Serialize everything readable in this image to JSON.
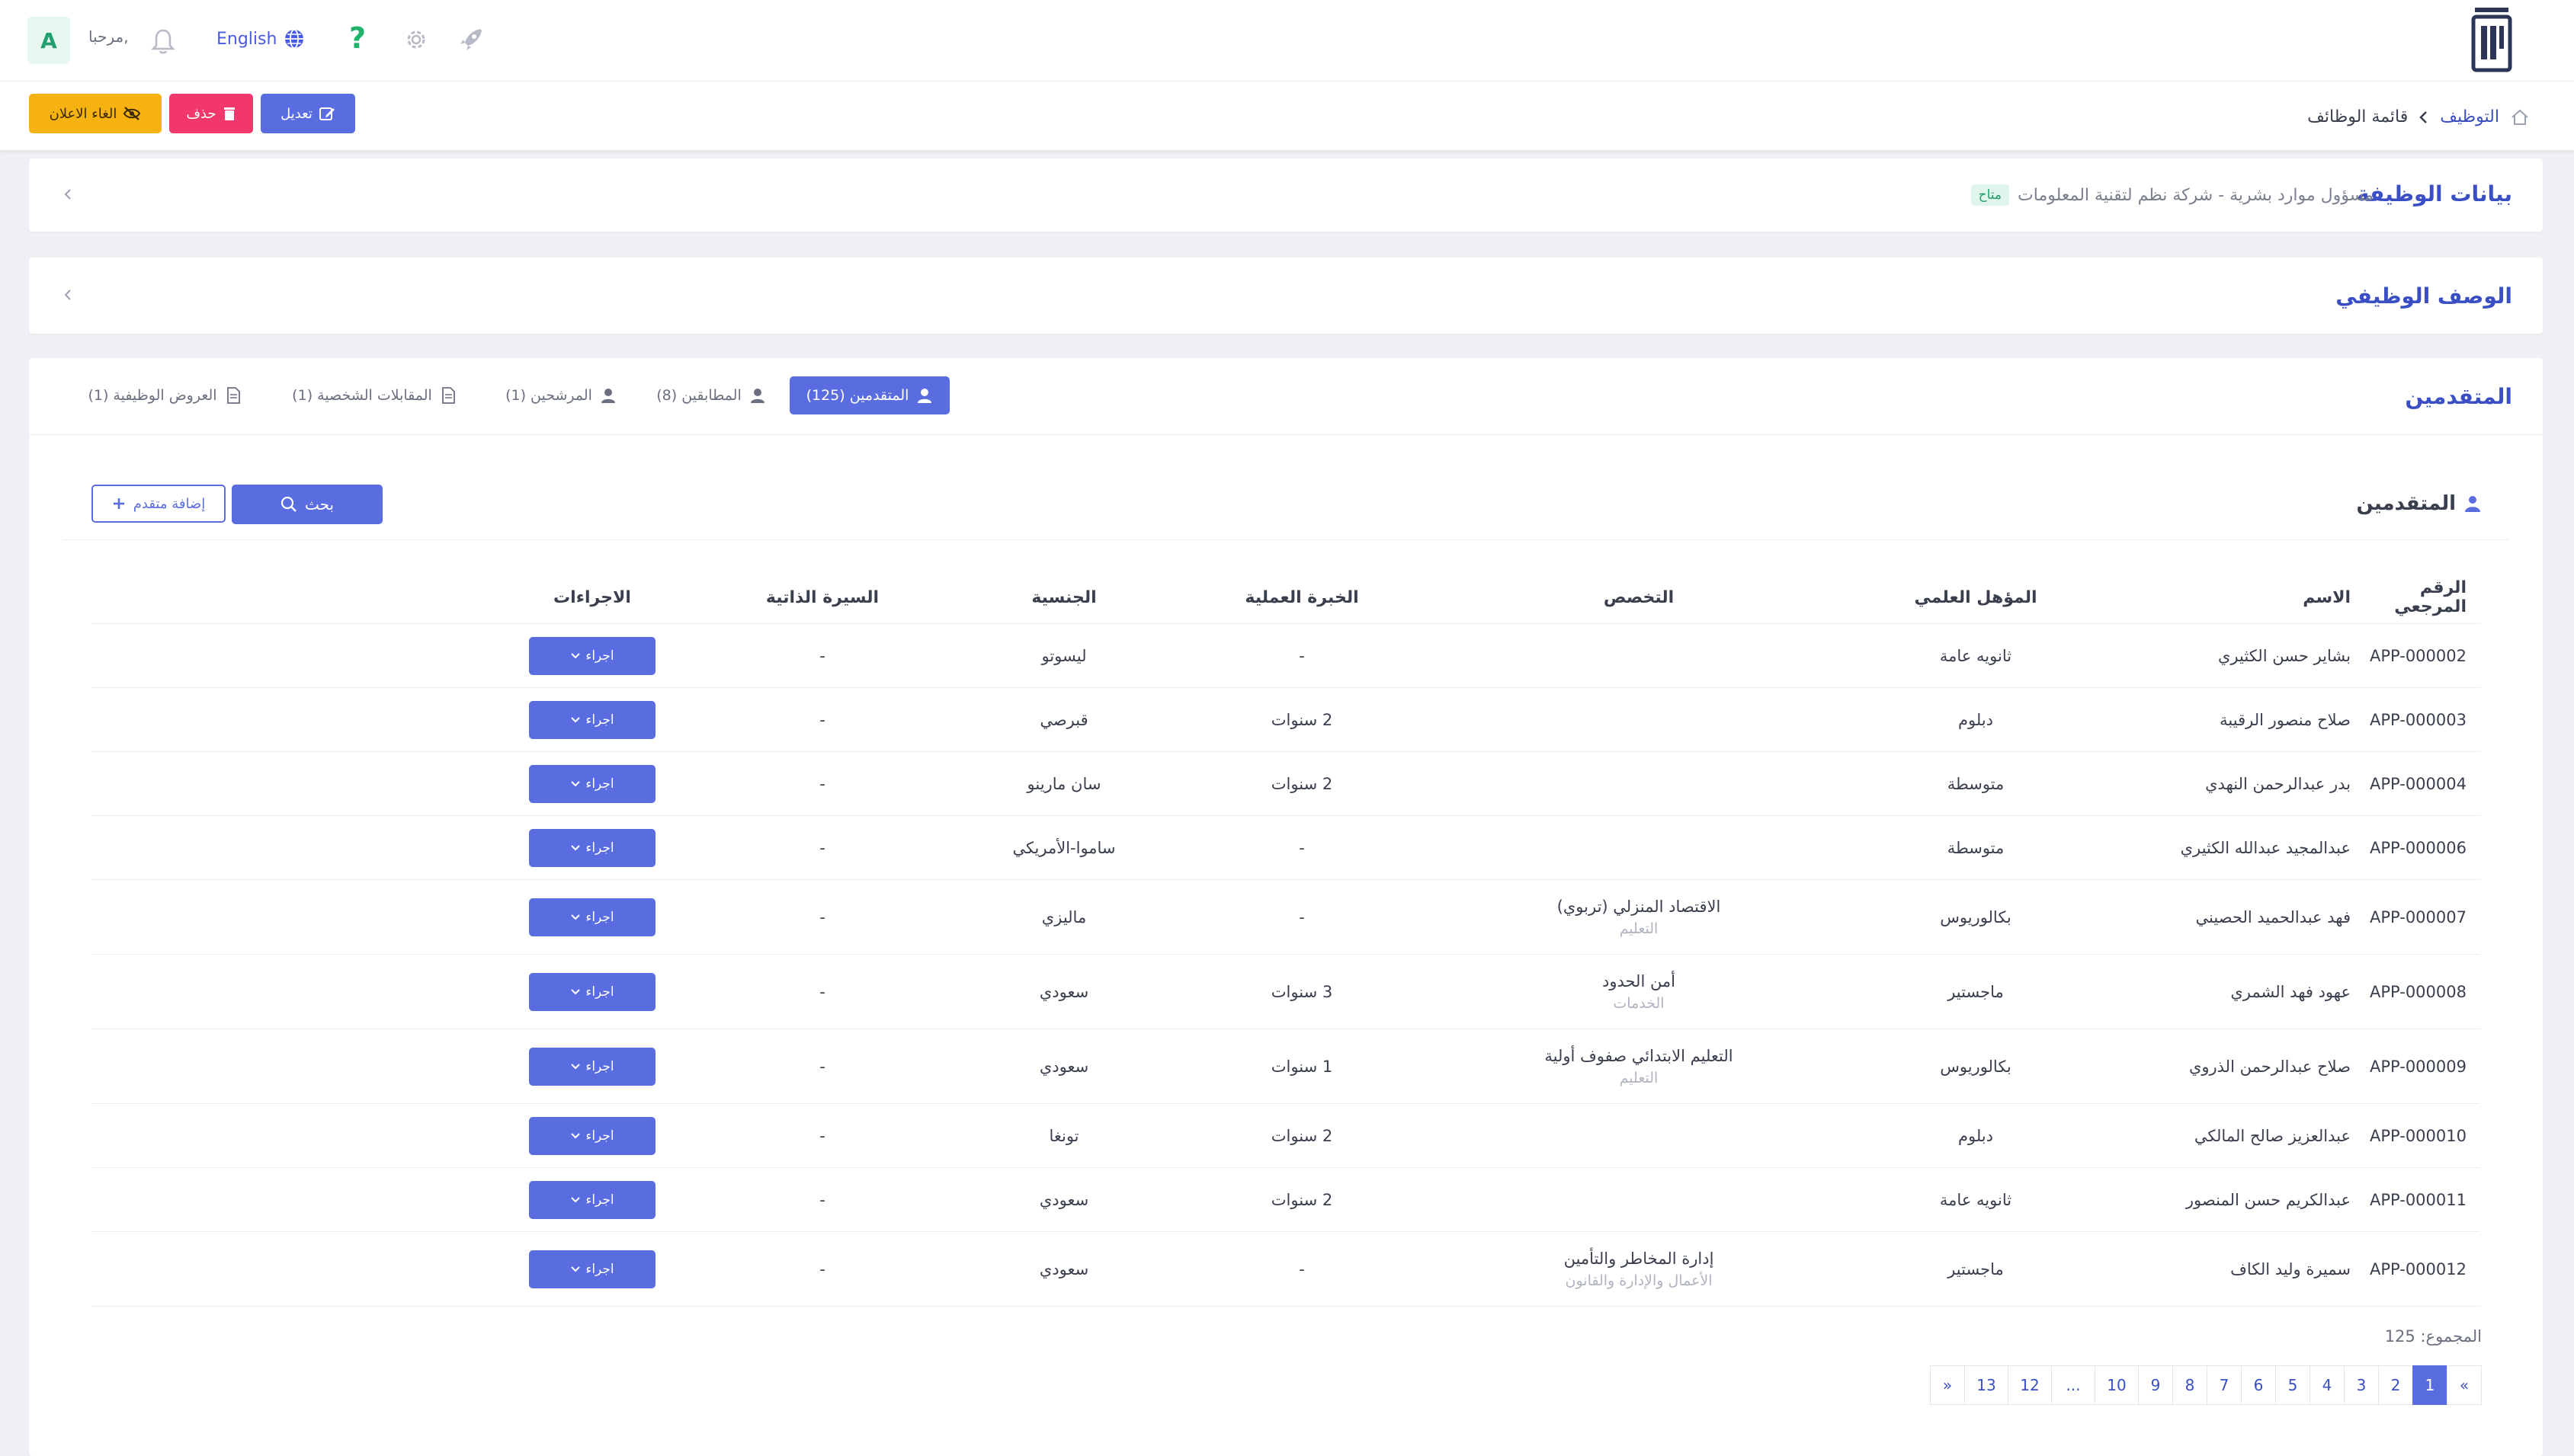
{
  "topbar": {
    "avatar_letter": "A",
    "greeting": "مرحبا,",
    "language": "English",
    "help_glyph": "?"
  },
  "actions": {
    "cancel_ad": "الغاء الاعلان",
    "delete": "حذف",
    "edit": "تعديل"
  },
  "breadcrumb": {
    "root": "التوظيف",
    "current": "قائمة الوظائف"
  },
  "job_card": {
    "title": "بيانات الوظيفة",
    "subtitle": "مسؤول موارد بشرية - شركة نظم لتقنية المعلومات",
    "status": "متاح"
  },
  "description_card": {
    "title": "الوصف الوظيفي"
  },
  "applicants_card": {
    "title": "المتقدمين",
    "tabs": [
      {
        "label": "المتقدمين (125)",
        "active": true
      },
      {
        "label": "المطابقين (8)",
        "active": false
      },
      {
        "label": "المرشحين (1)",
        "active": false
      },
      {
        "label": "المقابلات الشخصية (1)",
        "active": false
      },
      {
        "label": "العروض الوظيفية (1)",
        "active": false
      }
    ],
    "section_title": "المتقدمين",
    "search_label": "بحث",
    "add_label": "إضافة متقدم",
    "columns": [
      "الرقم المرجعي",
      "الاسم",
      "المؤهل العلمي",
      "التخصص",
      "الخبرة العملية",
      "الجنسية",
      "السيرة الذاتية",
      "الاجراءات"
    ],
    "action_label": "اجراء",
    "rows": [
      {
        "ref": "APP-000002",
        "name": "بشاير حسن الكثيري",
        "qualification": "ثانويه عامة",
        "spec": "",
        "spec_sub": "",
        "experience": "-",
        "nationality": "ليسوتو",
        "cv": "-"
      },
      {
        "ref": "APP-000003",
        "name": "صلاح منصور الرقيبة",
        "qualification": "دبلوم",
        "spec": "",
        "spec_sub": "",
        "experience": "2 سنوات",
        "nationality": "قبرصي",
        "cv": "-"
      },
      {
        "ref": "APP-000004",
        "name": "بدر عبدالرحمن النهدي",
        "qualification": "متوسطة",
        "spec": "",
        "spec_sub": "",
        "experience": "2 سنوات",
        "nationality": "سان مارينو",
        "cv": "-"
      },
      {
        "ref": "APP-000006",
        "name": "عبدالمجيد عبدالله الكثيري",
        "qualification": "متوسطة",
        "spec": "",
        "spec_sub": "",
        "experience": "-",
        "nationality": "ساموا-الأمريكي",
        "cv": "-"
      },
      {
        "ref": "APP-000007",
        "name": "فهد عبدالحميد الحصيني",
        "qualification": "بكالوريوس",
        "spec": "الاقتصاد المنزلي (تربوي)",
        "spec_sub": "التعليم",
        "experience": "-",
        "nationality": "ماليزي",
        "cv": "-"
      },
      {
        "ref": "APP-000008",
        "name": "عهود فهد الشمري",
        "qualification": "ماجستير",
        "spec": "أمن الحدود",
        "spec_sub": "الخدمات",
        "experience": "3 سنوات",
        "nationality": "سعودي",
        "cv": "-"
      },
      {
        "ref": "APP-000009",
        "name": "صلاح عبدالرحمن الذروي",
        "qualification": "بكالوريوس",
        "spec": "التعليم الابتدائي صفوف أولية",
        "spec_sub": "التعليم",
        "experience": "1 سنوات",
        "nationality": "سعودي",
        "cv": "-"
      },
      {
        "ref": "APP-000010",
        "name": "عبدالعزيز صالح المالكي",
        "qualification": "دبلوم",
        "spec": "",
        "spec_sub": "",
        "experience": "2 سنوات",
        "nationality": "تونغا",
        "cv": "-"
      },
      {
        "ref": "APP-000011",
        "name": "عبدالكريم حسن المنصور",
        "qualification": "ثانويه عامة",
        "spec": "",
        "spec_sub": "",
        "experience": "2 سنوات",
        "nationality": "سعودي",
        "cv": "-"
      },
      {
        "ref": "APP-000012",
        "name": "سميرة وليد الكاف",
        "qualification": "ماجستير",
        "spec": "إدارة المخاطر والتأمين",
        "spec_sub": "الأعمال والإدارة والقانون",
        "experience": "-",
        "nationality": "سعودي",
        "cv": "-"
      }
    ],
    "total_label": "المجموع:",
    "total_value": "125",
    "pages": [
      "«",
      "1",
      "2",
      "3",
      "4",
      "5",
      "6",
      "7",
      "8",
      "9",
      "10",
      "...",
      "12",
      "13",
      "»"
    ],
    "active_page": "1"
  },
  "colors": {
    "primary": "#5a6de0",
    "warning": "#f5b210",
    "danger": "#f1376c",
    "success": "#22a06b"
  }
}
